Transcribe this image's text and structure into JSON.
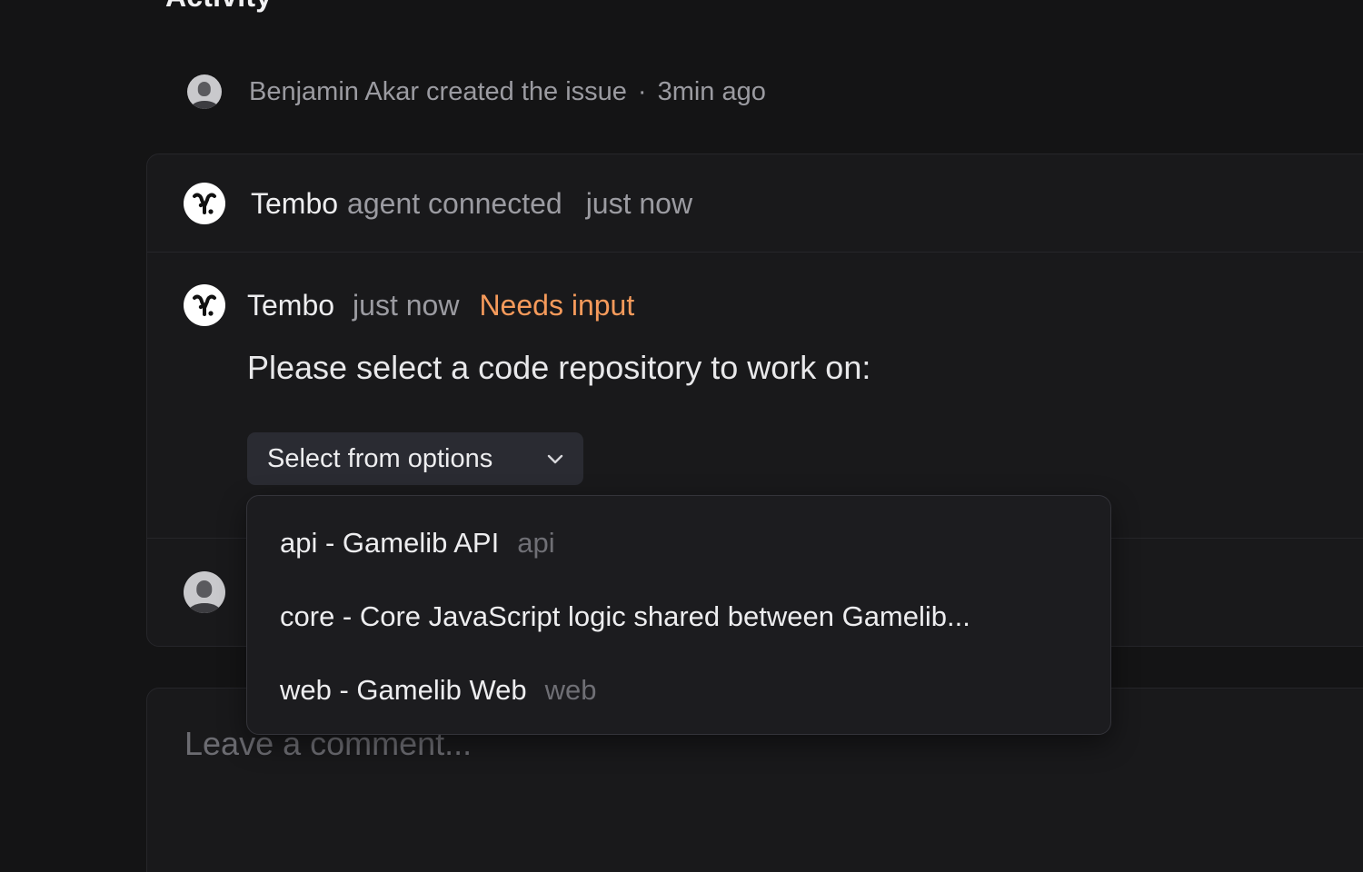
{
  "activity": {
    "title": "Activity",
    "created": {
      "text": "Benjamin Akar created the issue",
      "separator": "·",
      "time": "3min ago"
    }
  },
  "timeline": {
    "connected": {
      "name": "Tembo",
      "action": "agent connected",
      "time": "just now"
    },
    "message": {
      "name": "Tembo",
      "time": "just now",
      "status": "Needs input",
      "status_color": "#f59a5b",
      "body": "Please select a code repository to work on:",
      "select_label": "Select from options"
    }
  },
  "dropdown": {
    "options": [
      {
        "label": "api - Gamelib API",
        "sub": "api"
      },
      {
        "label": "core - Core JavaScript logic shared between Gamelib...",
        "sub": ""
      },
      {
        "label": "web - Gamelib Web",
        "sub": "web"
      }
    ]
  },
  "comment": {
    "placeholder": "Leave a comment..."
  },
  "icons": {
    "avatar": "user-avatar",
    "bot": "tembo-logo-icon",
    "chevron": "chevron-down-icon"
  },
  "colors": {
    "background": "#141415",
    "card": "#19191b",
    "accent": "#f59a5b"
  }
}
